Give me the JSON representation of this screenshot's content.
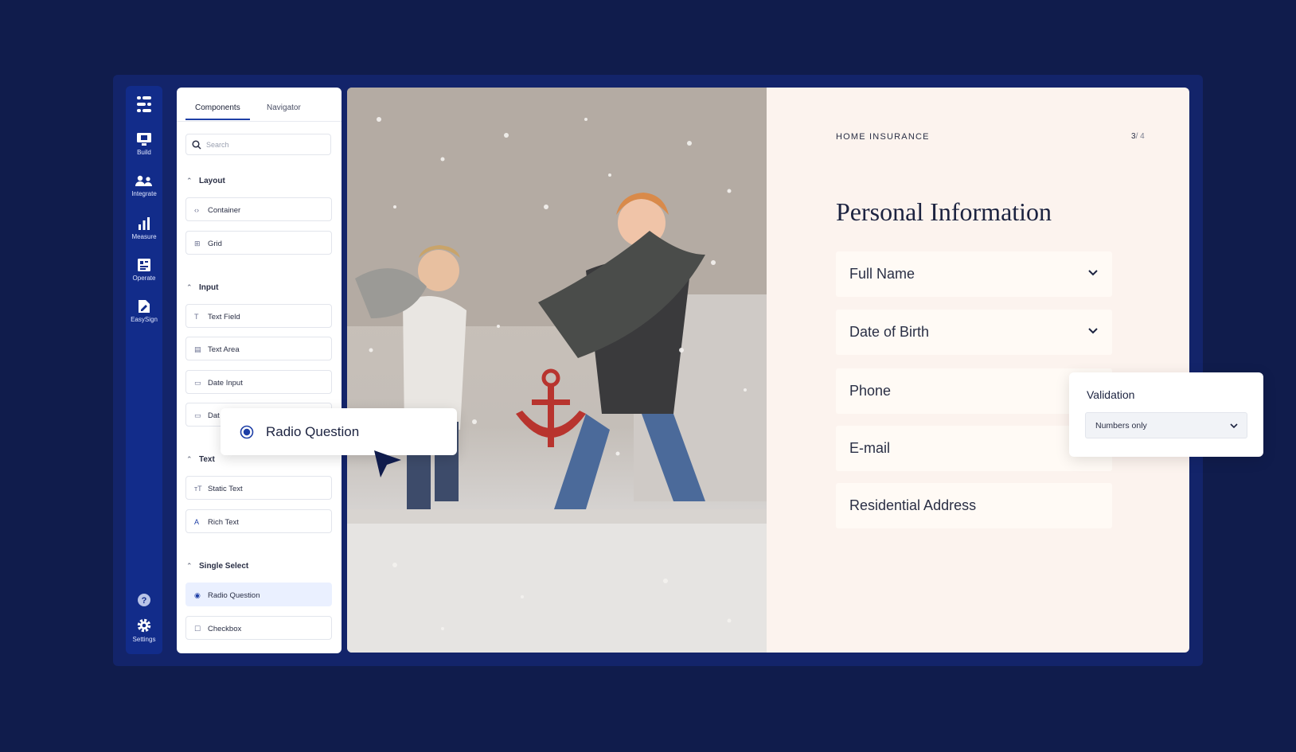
{
  "rail": {
    "items": [
      {
        "label": "Build",
        "icon": "monitor-icon"
      },
      {
        "label": "Integrate",
        "icon": "people-icon"
      },
      {
        "label": "Measure",
        "icon": "bar-chart-icon"
      },
      {
        "label": "Operate",
        "icon": "document-grid-icon"
      },
      {
        "label": "EasySign",
        "icon": "sign-icon"
      }
    ],
    "settings_label": "Settings",
    "help_icon": "help-icon"
  },
  "panel": {
    "tabs": [
      "Components",
      "Navigator"
    ],
    "search_placeholder": "Search",
    "sections": [
      {
        "title": "Layout",
        "items": [
          {
            "label": "Container",
            "icon": "code-icon"
          },
          {
            "label": "Grid",
            "icon": "grid-icon"
          }
        ]
      },
      {
        "title": "Input",
        "items": [
          {
            "label": "Text Field",
            "icon": "text-icon"
          },
          {
            "label": "Text Area",
            "icon": "textarea-icon"
          },
          {
            "label": "Date Input",
            "icon": "calendar-icon"
          },
          {
            "label": "Dat",
            "icon": "calendar-icon"
          }
        ]
      },
      {
        "title": "Text",
        "items": [
          {
            "label": "Static Text",
            "icon": "static-text-icon"
          },
          {
            "label": "Rich Text",
            "icon": "rich-text-icon"
          }
        ]
      },
      {
        "title": "Single Select",
        "items": [
          {
            "label": "Radio Question",
            "icon": "radio-icon",
            "selected": true
          },
          {
            "label": "Checkbox",
            "icon": "checkbox-icon"
          }
        ]
      }
    ]
  },
  "drag_preview": {
    "label": "Radio Question"
  },
  "form": {
    "eyebrow": "HOME INSURANCE",
    "page_current": "3",
    "page_total": "/ 4",
    "title": "Personal Information",
    "fields": [
      {
        "label": "Full Name",
        "dropdown": true
      },
      {
        "label": "Date of Birth",
        "dropdown": true
      },
      {
        "label": "Phone",
        "dropdown": false
      },
      {
        "label": "E-mail",
        "dropdown": false
      },
      {
        "label": "Residential Address",
        "dropdown": false
      }
    ]
  },
  "validation": {
    "title": "Validation",
    "selected": "Numbers only"
  },
  "colors": {
    "background": "#101c4c",
    "rail": "#122c8a",
    "accent": "#1e3fa6",
    "form_bg": "#fcf3ee"
  }
}
